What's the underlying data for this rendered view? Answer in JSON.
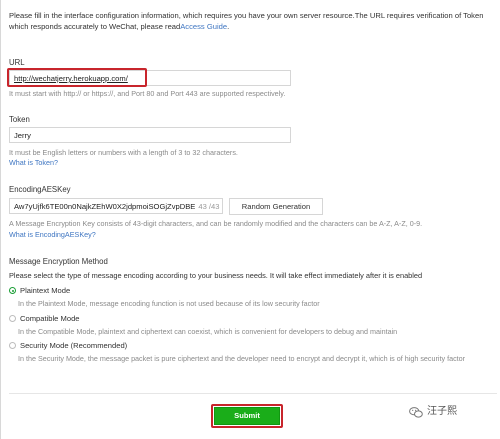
{
  "intro": {
    "text": "Please fill in the interface configuration information, which requires you have your own server resource.The URL requires verification of Token which responds accurately to WeChat, please read",
    "link": "Access Guide",
    "end": "."
  },
  "url": {
    "label": "URL",
    "value": "http://wechatjerry.herokuapp.com/",
    "hint": "It must start with http:// or https://, and Port 80 and Port 443 are supported respectively."
  },
  "token": {
    "label": "Token",
    "value": "Jerry",
    "hint": "It must be English letters or numbers with a length of 3 to 32 characters.",
    "help_link": "What is Token?"
  },
  "aes": {
    "label": "EncodingAESKey",
    "value": "Aw7yUjfk6TE00n0NajkZEhW0X2jdpmoiSOGjZvpDBE",
    "counter": "43 /43",
    "generate_label": "Random Generation",
    "hint": "A Message Encryption Key consists of 43-digit characters, and can be randomly modified and the characters can be A-Z, A-Z, 0-9.",
    "help_link": "What is EncodingAESKey?"
  },
  "encryption": {
    "label": "Message Encryption Method",
    "hint": "Please select the type of message encoding according to your business needs. It will take effect immediately after it is enabled",
    "options": [
      {
        "label": "Plaintext Mode",
        "desc": "In the Plaintext Mode, message encoding function is not used because of its low security factor",
        "checked": true
      },
      {
        "label": "Compatible Mode",
        "desc": "In the Compatible Mode, plaintext and ciphertext can coexist, which is convenient for developers to debug and maintain",
        "checked": false
      },
      {
        "label": "Security Mode (Recommended)",
        "desc": "In the Security Mode, the message packet is pure ciphertext and the developer need to encrypt and decrypt it, which is of high security factor",
        "checked": false
      }
    ]
  },
  "submit_label": "Submit",
  "watermark": "汪子熙",
  "colors": {
    "accent": "#1aad19",
    "link": "#3f76c2",
    "highlight": "#c8252c"
  }
}
